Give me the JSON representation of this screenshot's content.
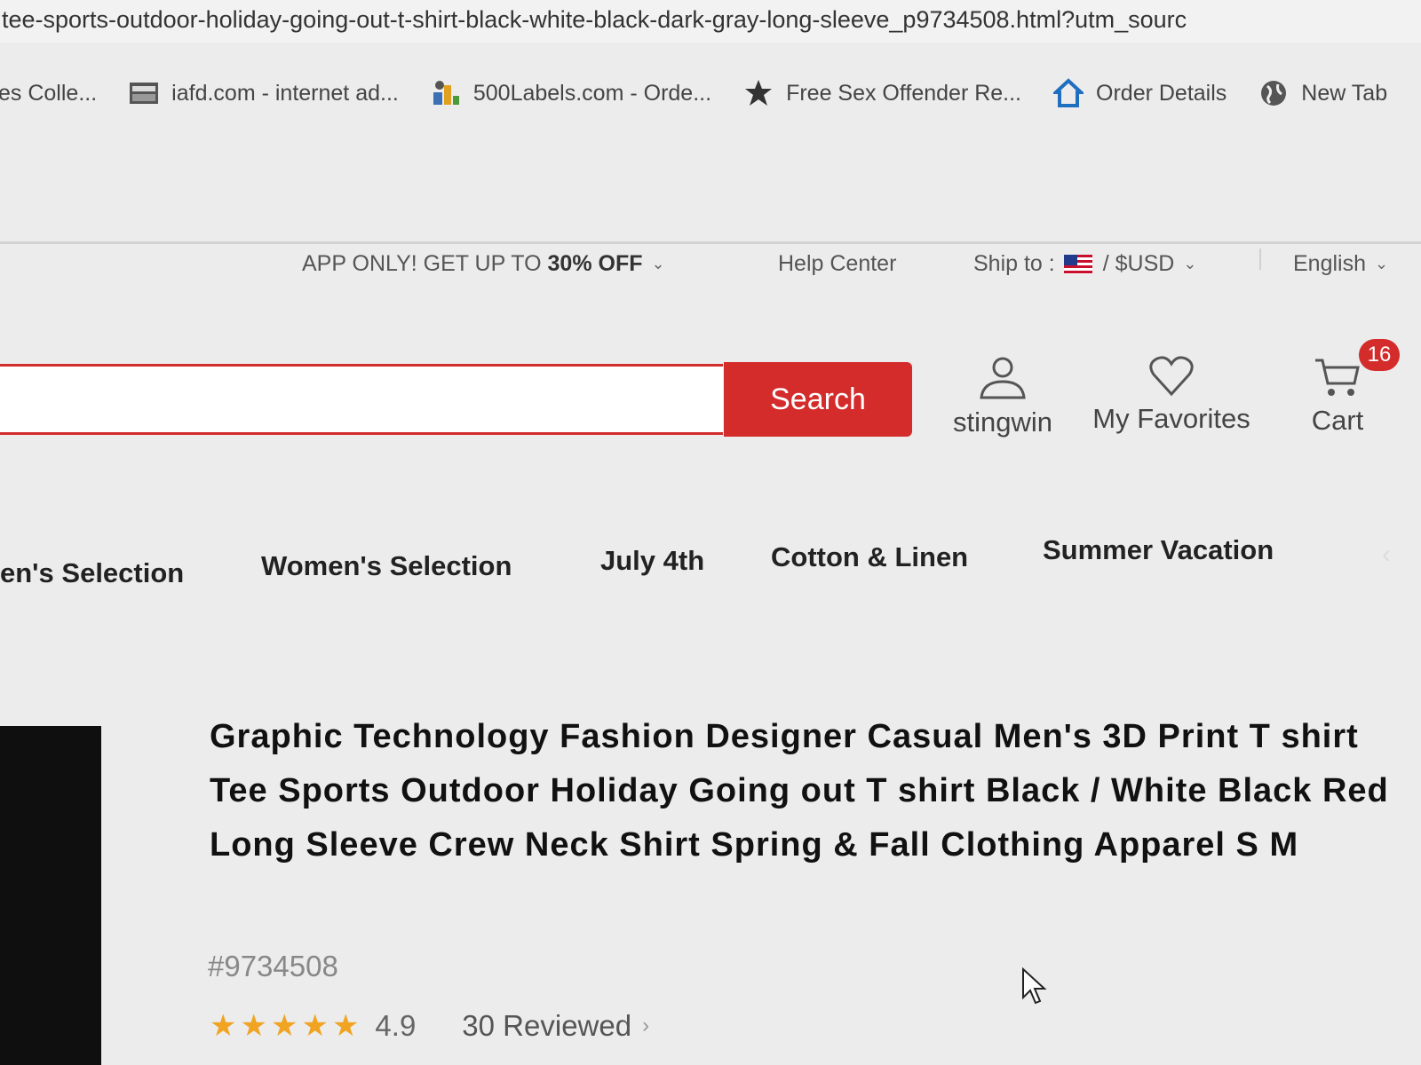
{
  "browser": {
    "url": "tee-sports-outdoor-holiday-going-out-t-shirt-black-white-black-dark-gray-long-sleeve_p9734508.html?utm_sourc",
    "bookmarks": [
      {
        "icon": "bookmark-icon",
        "label": "es Colle..."
      },
      {
        "icon": "iafd-icon",
        "label": "iafd.com - internet ad..."
      },
      {
        "icon": "labels-icon",
        "label": "500Labels.com - Orde..."
      },
      {
        "icon": "offender-icon",
        "label": "Free Sex Offender Re..."
      },
      {
        "icon": "home-icon",
        "label": "Order Details"
      },
      {
        "icon": "globe-icon",
        "label": "New Tab"
      }
    ]
  },
  "topbar": {
    "promo_prefix": "APP ONLY! GET UP TO ",
    "promo_bold": "30% OFF",
    "help": "Help Center",
    "ship_to": "Ship to :",
    "currency": "/ $USD",
    "language": "English"
  },
  "search": {
    "placeholder": "",
    "button": "Search"
  },
  "account": {
    "user": "stingwin",
    "favorites": "My Favorites",
    "cart": "Cart",
    "cart_count": "16"
  },
  "nav": {
    "tabs": [
      "en's Selection",
      "Women's Selection",
      "July 4th",
      "Cotton & Linen",
      "Summer Vacation"
    ]
  },
  "product": {
    "title": "Graphic Technology Fashion Designer Casual Men's 3D Print T shirt Tee Sports Outdoor Holiday Going out T shirt Black / White Black Red Long Sleeve Crew Neck Shirt Spring & Fall Clothing Apparel S M",
    "sku": "#9734508",
    "rating": "4.9",
    "rating_stars": 5,
    "reviews": "30 Reviewed"
  },
  "colors": {
    "accent": "#d42b2b",
    "star": "#f0a422"
  }
}
